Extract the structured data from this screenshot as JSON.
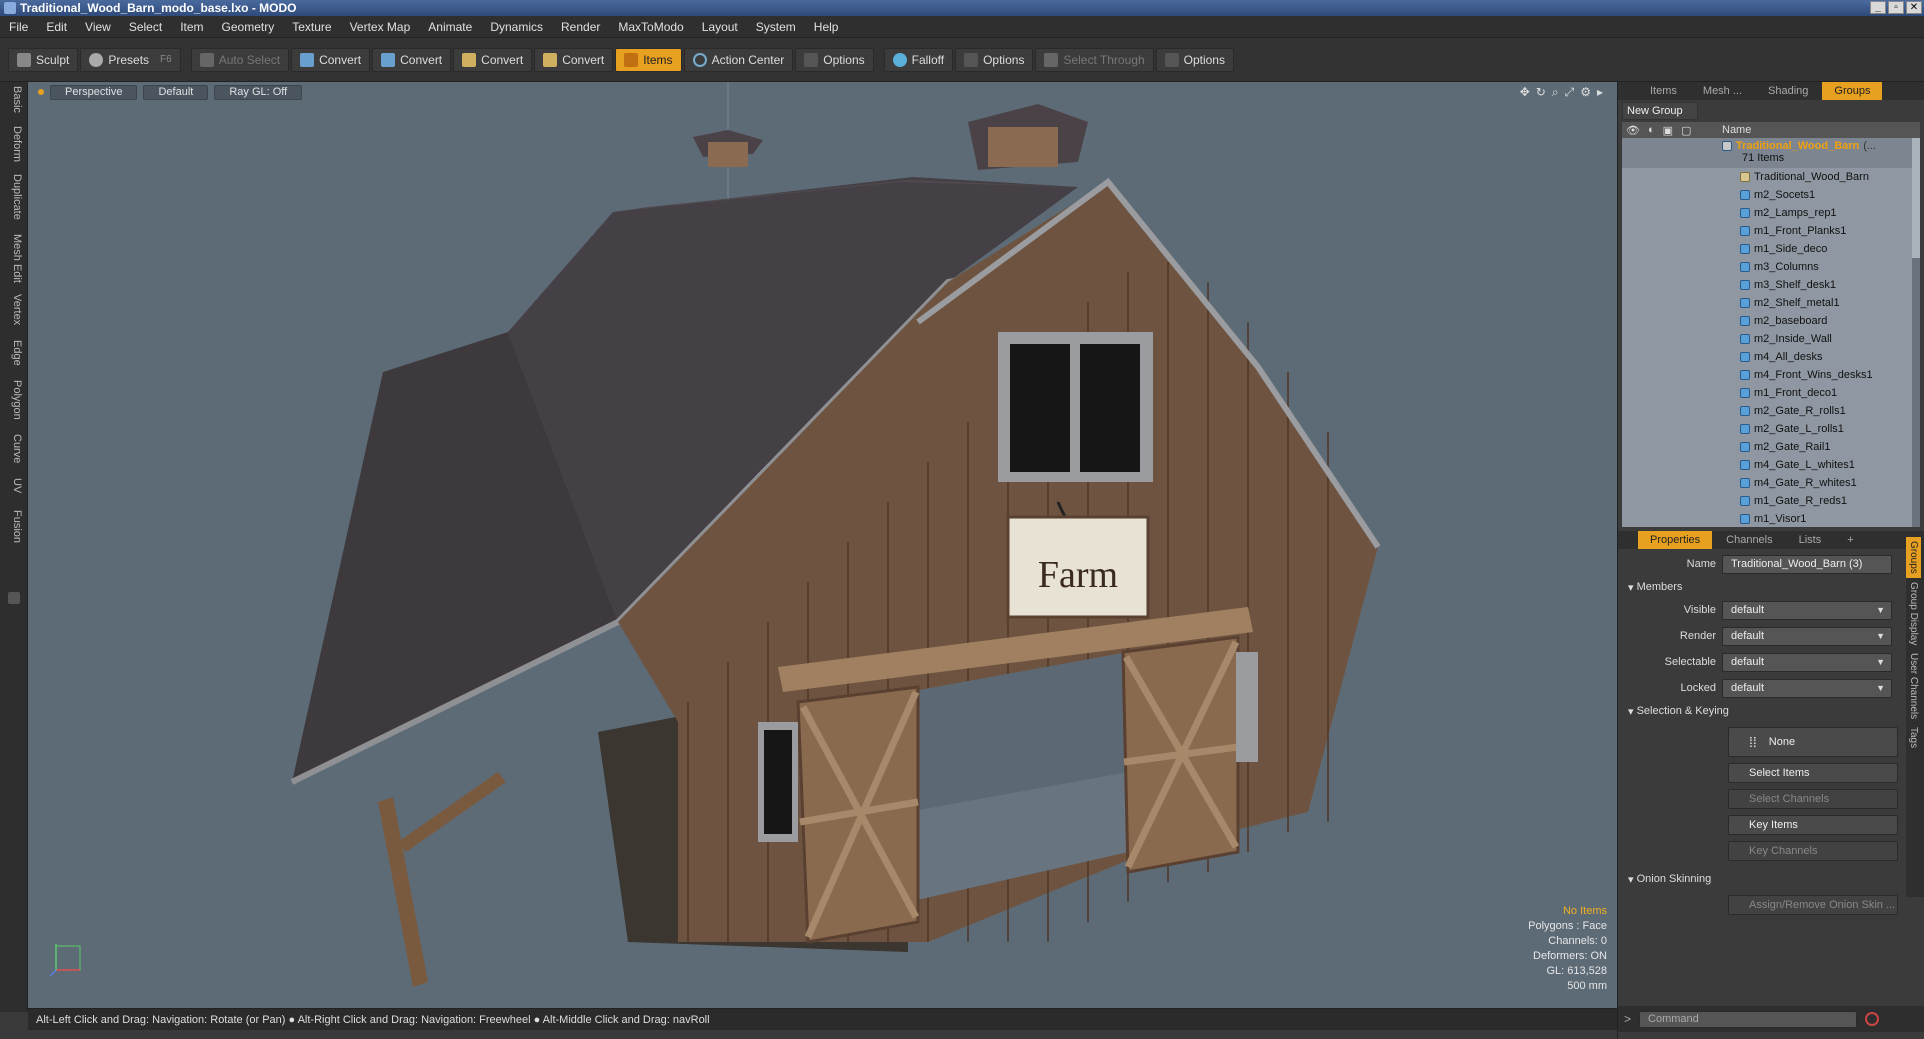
{
  "window": {
    "title": "Traditional_Wood_Barn_modo_base.lxo - MODO"
  },
  "menu": [
    "File",
    "Edit",
    "View",
    "Select",
    "Item",
    "Geometry",
    "Texture",
    "Vertex Map",
    "Animate",
    "Dynamics",
    "Render",
    "MaxToModo",
    "Layout",
    "System",
    "Help"
  ],
  "toolbar": {
    "sculpt": "Sculpt",
    "presets": "Presets",
    "presets_hotkey": "F6",
    "auto_select": "Auto Select",
    "convert1": "Convert",
    "convert2": "Convert",
    "convert3": "Convert",
    "convert4": "Convert",
    "items": "Items",
    "action_center": "Action Center",
    "options1": "Options",
    "falloff": "Falloff",
    "options2": "Options",
    "select_through": "Select Through",
    "options3": "Options"
  },
  "left_tabs": [
    "Basic",
    "Deform",
    "Duplicate",
    "Mesh Edit",
    "Vertex",
    "Edge",
    "Polygon",
    "Curve",
    "UV",
    "Fusion"
  ],
  "viewport": {
    "view": "Perspective",
    "shading": "Default",
    "raygl": "Ray GL: Off",
    "sign_text": "Farm"
  },
  "stats": {
    "items": "No Items",
    "polygons": "Polygons : Face",
    "channels": "Channels: 0",
    "deformers": "Deformers: ON",
    "gl": "GL: 613,528",
    "scale": "500 mm"
  },
  "status": "Alt-Left Click and Drag: Navigation: Rotate (or Pan) ●  Alt-Right Click and Drag: Navigation: Freewheel ●  Alt-Middle Click and Drag: navRoll",
  "panel_tabs": [
    "Items",
    "Mesh ...",
    "Shading",
    "Groups"
  ],
  "new_group": "New Group",
  "list_header": "Name",
  "group": {
    "name": "Traditional_Wood_Barn",
    "suffix": "(...",
    "count": "71 Items"
  },
  "items": [
    "Traditional_Wood_Barn",
    "m2_Socets1",
    "m2_Lamps_rep1",
    "m1_Front_Planks1",
    "m1_Side_deco",
    "m3_Columns",
    "m3_Shelf_desk1",
    "m2_Shelf_metal1",
    "m2_baseboard",
    "m2_Inside_Wall",
    "m4_All_desks",
    "m4_Front_Wins_desks1",
    "m1_Front_deco1",
    "m2_Gate_R_rolls1",
    "m2_Gate_L_rolls1",
    "m2_Gate_Rail1",
    "m4_Gate_L_whites1",
    "m4_Gate_R_whites1",
    "m1_Gate_R_reds1",
    "m1_Visor1"
  ],
  "props_tabs": [
    "Properties",
    "Channels",
    "Lists",
    "+"
  ],
  "props": {
    "name_label": "Name",
    "name_value": "Traditional_Wood_Barn (3)",
    "members": "Members",
    "visible_label": "Visible",
    "visible_value": "default",
    "render_label": "Render",
    "render_value": "default",
    "selectable_label": "Selectable",
    "selectable_value": "default",
    "locked_label": "Locked",
    "locked_value": "default",
    "sel_keying": "Selection & Keying",
    "none": "None",
    "select_items": "Select Items",
    "select_channels": "Select Channels",
    "key_items": "Key Items",
    "key_channels": "Key Channels",
    "onion": "Onion Skinning",
    "assign_onion": "Assign/Remove Onion Skin ..."
  },
  "side_tabs": [
    "Groups",
    "Group Display",
    "User Channels",
    "Tags"
  ],
  "command_placeholder": "Command",
  "colors": {
    "accent": "#e8a020",
    "viewport_bg": "#5d6b77",
    "group_name": "#f0a010"
  }
}
